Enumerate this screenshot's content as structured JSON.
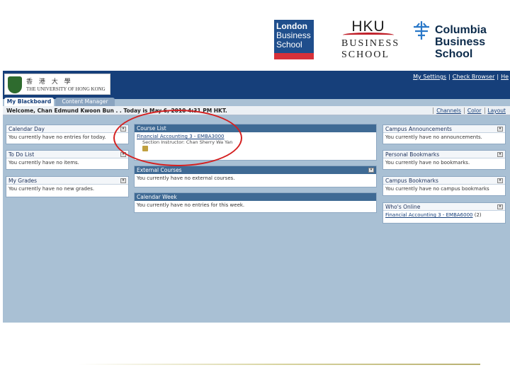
{
  "logos": {
    "london": {
      "lines": [
        "London",
        "Business",
        "School"
      ],
      "brand_color": "#1f4e8c",
      "accent_color": "#d6313a"
    },
    "hku": {
      "mark": "HKU",
      "line1": "BUSINESS",
      "line2": "SCHOOL",
      "accent_color": "#c0202a"
    },
    "columbia": {
      "lines": [
        "Columbia",
        "Business",
        "School"
      ],
      "brand_color": "#0b2a4a"
    }
  },
  "banner": {
    "chinese": "香 港 大 學",
    "name": "THE UNIVERSITY OF HONG KONG"
  },
  "top_links": [
    "My Settings",
    "Check Browser",
    "He"
  ],
  "tabs": [
    "My Blackboard",
    "Content Manager"
  ],
  "welcome": "Welcome, Chan Edmund Kwoon Bun . . Today is May 6, 2010 4:31 PM HKT.",
  "welcome_links": [
    "Channels",
    "Color",
    "Layout"
  ],
  "modules": {
    "calendar_day": {
      "title": "Calendar Day",
      "text": "You currently have no entries for today."
    },
    "todo": {
      "title": "To Do List",
      "text": "You currently have no items."
    },
    "grades": {
      "title": "My Grades",
      "text": "You currently have no new grades."
    },
    "course_list": {
      "title": "Course List",
      "course": "Financial Accounting 3 - EMBA3000",
      "instructor": "Section Instructor: Chan Sherry Wa Yan"
    },
    "external_courses": {
      "title": "External Courses",
      "text": "You currently have no external courses."
    },
    "calendar_week": {
      "title": "Calendar Week",
      "text": "You currently have no entries for this week."
    },
    "campus_announcements": {
      "title": "Campus Announcements",
      "text": "You currently have no announcements."
    },
    "personal_bookmarks": {
      "title": "Personal Bookmarks",
      "text": "You currently have no bookmarks."
    },
    "campus_bookmarks": {
      "title": "Campus Bookmarks",
      "text": "You currently have no campus bookmarks"
    },
    "whos_online": {
      "title": "Who's Online",
      "link": "Financial Accounting 3 - EMBA6000",
      "count": "(2)"
    }
  },
  "colors": {
    "bb_navy": "#163f7a",
    "page_bg": "#a9c0d4",
    "module_header": "#3f6a94",
    "highlight": "#d42020"
  }
}
